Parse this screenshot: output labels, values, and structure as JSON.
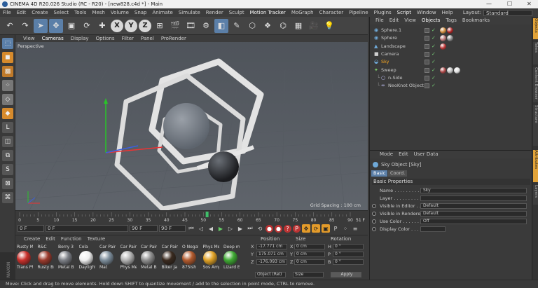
{
  "titlebar": {
    "title": "CINEMA 4D R20.026 Studio (RC - R20) - [new828.c4d *] - Main",
    "minimize": "—",
    "maximize": "☐",
    "close": "✕"
  },
  "menu": [
    "File",
    "Edit",
    "Create",
    "Select",
    "Tools",
    "Mesh",
    "Volume",
    "Snap",
    "Animate",
    "Simulate",
    "Render",
    "Sculpt",
    "Motion Tracker",
    "MoGraph",
    "Character",
    "Pipeline",
    "Plugins",
    "Script",
    "Window",
    "Help"
  ],
  "layout": {
    "label": "Layout:",
    "value": "Standard"
  },
  "viewport": {
    "menu": [
      "View",
      "Cameras",
      "Display",
      "Options",
      "Filter",
      "Panel",
      "ProRender"
    ],
    "label": "Perspective",
    "grid_spacing": "Grid Spacing : 100 cm"
  },
  "timeline": {
    "ticks": [
      "0",
      "5",
      "10",
      "15",
      "20",
      "25",
      "30",
      "35",
      "40",
      "45",
      "50",
      "55",
      "60",
      "65",
      "70",
      "75",
      "80",
      "85",
      "90"
    ],
    "current_frame": "51 F",
    "playhead_fraction": 0.567
  },
  "transport": {
    "start": "0 F",
    "current": "0 F",
    "end_left": "90 F",
    "end": "90 F"
  },
  "materials": {
    "menu": [
      "Create",
      "Edit",
      "Function",
      "Texture"
    ],
    "items": [
      {
        "top": "Rusty Me",
        "bottom": "Trans Ph",
        "color": "#c9302b"
      },
      {
        "top": "R&C",
        "bottom": "Rusty Br",
        "color": "#9b3a2c"
      },
      {
        "top": "Berry 3",
        "bottom": "Metal B",
        "color": "#7c7f86"
      },
      {
        "top": "Cola",
        "bottom": "Daylight",
        "color": "#f0f0f0"
      },
      {
        "top": "Car Pain",
        "bottom": "Mat",
        "color": "#7d8e9c"
      },
      {
        "top": "Car Pain",
        "bottom": "Phys Me",
        "color": "#b3b3b3"
      },
      {
        "top": "Car Pain",
        "bottom": "Metal B",
        "color": "#8f8f8f"
      },
      {
        "top": "Car Pain",
        "bottom": "Biker Ja",
        "color": "#3a2a1f"
      },
      {
        "top": "O Negat",
        "bottom": "875ish",
        "color": "#b25a2d"
      },
      {
        "top": "Phys Me",
        "bottom": "Sos Amp",
        "color": "#e0a226"
      },
      {
        "top": "Deep m",
        "bottom": "Lizard E",
        "color": "#3faa33"
      }
    ]
  },
  "coords": {
    "headers": [
      "Position",
      "Size",
      "Rotation"
    ],
    "rows": [
      {
        "axis": "X",
        "pos": "-17.771 cm",
        "size": "0 cm",
        "rot_label": "H",
        "rot": "0 °"
      },
      {
        "axis": "Y",
        "pos": "175.071 cm",
        "size": "0 cm",
        "rot_label": "P",
        "rot": "0 °"
      },
      {
        "axis": "Z",
        "pos": "-176.093 cm",
        "size": "0 cm",
        "rot_label": "B",
        "rot": "0 °"
      }
    ],
    "mode": "Object (Rel)",
    "size_mode": "Size",
    "apply": "Apply"
  },
  "objects": {
    "tabs": [
      "File",
      "Edit",
      "View",
      "Objects",
      "Tags",
      "Bookmarks"
    ],
    "items": [
      {
        "name": "Sphere.1",
        "indent": 0,
        "icon": "◉",
        "icon_color": "#6fa9d8",
        "tags": [
          "#d08a3a",
          "#a22"
        ]
      },
      {
        "name": "Sphere",
        "indent": 0,
        "icon": "◉",
        "icon_color": "#6fa9d8",
        "tags": [
          "#b77",
          "#888"
        ]
      },
      {
        "name": "Landscape",
        "indent": 0,
        "icon": "▲",
        "icon_color": "#6fa9d8",
        "tags": [
          "#b33"
        ]
      },
      {
        "name": "Camera",
        "indent": 0,
        "icon": "■",
        "icon_color": "#cfcfcf",
        "tags": []
      },
      {
        "name": "Sky",
        "indent": 0,
        "icon": "◒",
        "icon_color": "#6fa9d8",
        "tags": [],
        "selected": true
      },
      {
        "name": "Sweep",
        "indent": 0,
        "icon": "✦",
        "icon_color": "#7fd06a",
        "tags": [
          "#a44",
          "#bbb",
          "#ddd"
        ]
      },
      {
        "name": "n-Side",
        "indent": 1,
        "icon": "○",
        "icon_color": "#c8c8ff",
        "tags": []
      },
      {
        "name": "NeoKnot Object",
        "indent": 1,
        "icon": "∞",
        "icon_color": "#c8c8ff",
        "tags": []
      }
    ]
  },
  "attributes": {
    "menu": [
      "Mode",
      "Edit",
      "User Data"
    ],
    "object_title": "Sky Object [Sky]",
    "tabs": [
      "Basic",
      "Coord."
    ],
    "section": "Basic Properties",
    "rows": [
      {
        "label": "Name . . . . . . . . . . . .",
        "value": "Sky",
        "radio": false
      },
      {
        "label": "Layer . . . . . . . . . . . .",
        "value": "",
        "radio": false
      },
      {
        "label": "Visible in Editor . .",
        "value": "Default",
        "radio": true
      },
      {
        "label": "Visible in Renderer",
        "value": "Default",
        "radio": true
      },
      {
        "label": "Use Color . . . . . . .",
        "value": "Off",
        "radio": true
      },
      {
        "label": "Display Color . . . .",
        "value": "",
        "radio": true
      }
    ]
  },
  "right_tabs": [
    "Objects",
    "Takes",
    "Content Browser",
    "Structure",
    "Attributes",
    "Layers"
  ],
  "status": "Move: Click and drag to move elements. Hold down SHIFT to quantize movement / add to the selection in point mode, CTRL to remove."
}
